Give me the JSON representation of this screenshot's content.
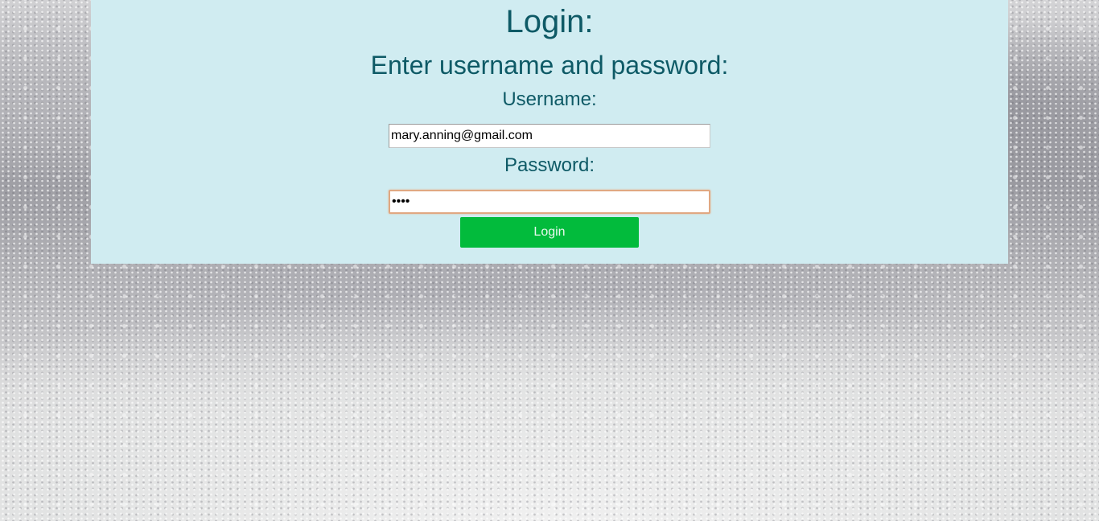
{
  "page": {
    "title": "Login:",
    "subtitle": "Enter username and password:"
  },
  "form": {
    "username_label": "Username:",
    "username_value": "mary.anning@gmail.com",
    "password_label": "Password:",
    "password_value": "••••",
    "login_button_label": "Login"
  },
  "colors": {
    "panel_background": "#d0ecf1",
    "heading_text": "#0e5a66",
    "login_button": "#02bb3c",
    "focused_input_border": "#e0a882"
  }
}
